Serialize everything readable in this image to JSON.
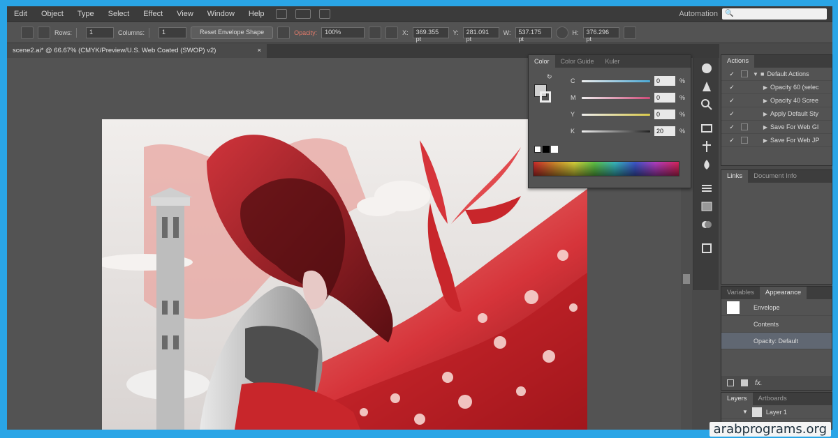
{
  "menu": {
    "items": [
      "Edit",
      "Object",
      "Type",
      "Select",
      "Effect",
      "View",
      "Window",
      "Help"
    ],
    "workspace": "Automation",
    "search_placeholder": ""
  },
  "control_bar": {
    "rows_label": "Rows:",
    "rows_value": "1",
    "columns_label": "Columns:",
    "columns_value": "1",
    "reset_button": "Reset Envelope Shape",
    "opacity_label": "Opacity:",
    "opacity_value": "100%",
    "x_value": "369.355 pt",
    "y_value": "281.091 pt",
    "w_value": "537.175 pt",
    "h_value": "376.296 pt"
  },
  "document": {
    "tab_title": "scene2.ai* @ 66.67% (CMYK/Preview/U.S. Web Coated (SWOP) v2)",
    "close_symbol": "×"
  },
  "color_panel": {
    "tabs": [
      "Color",
      "Color Guide",
      "Kuler"
    ],
    "sliders": [
      {
        "letter": "C",
        "value": "0",
        "color": "#4aa9d6"
      },
      {
        "letter": "M",
        "value": "0",
        "color": "#cf4a78"
      },
      {
        "letter": "Y",
        "value": "0",
        "color": "#d9c94a"
      },
      {
        "letter": "K",
        "value": "20",
        "color": "#cfcfcf"
      }
    ],
    "pct": "%"
  },
  "actions_panel": {
    "tab": "Actions",
    "items": [
      {
        "label": "Default Actions",
        "folder": true
      },
      {
        "label": "Opacity 60 (selec"
      },
      {
        "label": "Opacity 40 Scree"
      },
      {
        "label": "Apply Default Sty"
      },
      {
        "label": "Save For Web GI"
      },
      {
        "label": "Save For Web JP"
      }
    ]
  },
  "links_panel": {
    "tabs": [
      "Links",
      "Document Info"
    ]
  },
  "appearance_panel": {
    "tabs": [
      "Variables",
      "Appearance"
    ],
    "rows": [
      {
        "label": "Envelope"
      },
      {
        "label": "Contents"
      },
      {
        "label": "Opacity: Default"
      }
    ],
    "fx": "fx."
  },
  "layers_panel": {
    "tabs": [
      "Layers",
      "Artboards"
    ],
    "layer_name": "Layer 1"
  },
  "colors": {
    "accent_frame": "#2aa5e6",
    "art_red": "#c8262b",
    "art_dark_red": "#6d1418"
  },
  "watermark": "arabprograms.org"
}
